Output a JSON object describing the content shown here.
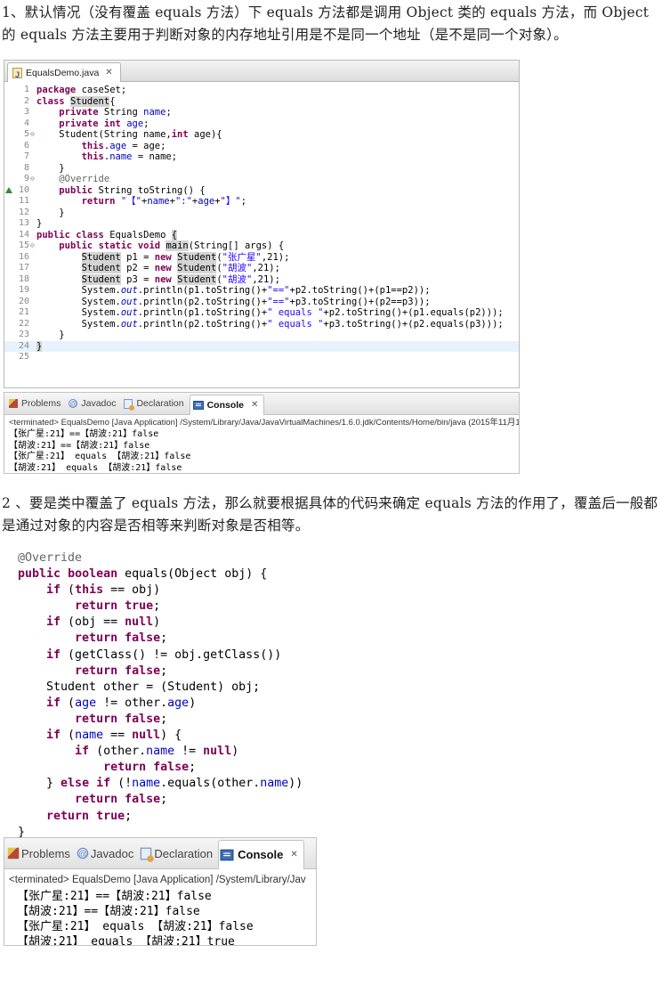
{
  "paragraphs": {
    "p1": "1、默认情况（没有覆盖 equals 方法）下 equals 方法都是调用 Object 类的 equals 方法，而 Object 的 equals 方法主要用于判断对象的内存地址引用是不是同一个地址（是不是同一个对象）。",
    "p2": "2 、要是类中覆盖了 equals 方法，那么就要根据具体的代码来确定 equals 方法的作用了，覆盖后一般都是通过对象的内容是否相等来判断对象是否相等。"
  },
  "editor": {
    "tab_title": "EqualsDemo.java",
    "tab_close": "✕",
    "icons": {
      "file": "java-file-icon",
      "fold": "fold-icon",
      "override": "override-marker-icon"
    },
    "line_numbers": [
      "1",
      "2",
      "3",
      "4",
      "5",
      "6",
      "7",
      "8",
      "9",
      "10",
      "11",
      "12",
      "13",
      "14",
      "15",
      "16",
      "17",
      "18",
      "19",
      "20",
      "21",
      "22",
      "23",
      "24",
      "25"
    ]
  },
  "views": {
    "problems": "Problems",
    "javadoc": "Javadoc",
    "declaration": "Declaration",
    "console": "Console",
    "close": "✕"
  },
  "console1": {
    "terminated": "<terminated> EqualsDemo [Java Application] /System/Library/Java/JavaVirtualMachines/1.6.0.jdk/Contents/Home/bin/java (2015年11月1",
    "lines": [
      "【张广星:21】==【胡波:21】false",
      "【胡波:21】==【胡波:21】false",
      "【张广星:21】 equals 【胡波:21】false",
      "【胡波:21】 equals 【胡波:21】false"
    ]
  },
  "console2": {
    "terminated": "<terminated> EqualsDemo [Java Application] /System/Library/Jav",
    "lines": [
      "【张广星:21】==【胡波:21】false",
      "【胡波:21】==【胡波:21】false",
      "【张广星:21】 equals 【胡波:21】false",
      "【胡波:21】 equals 【胡波:21】true"
    ]
  },
  "colors": {
    "keyword": "#7f0055",
    "field": "#0000c0",
    "string": "#2a00ff",
    "annotation": "#646464",
    "current_line": "#e8f2fe"
  }
}
